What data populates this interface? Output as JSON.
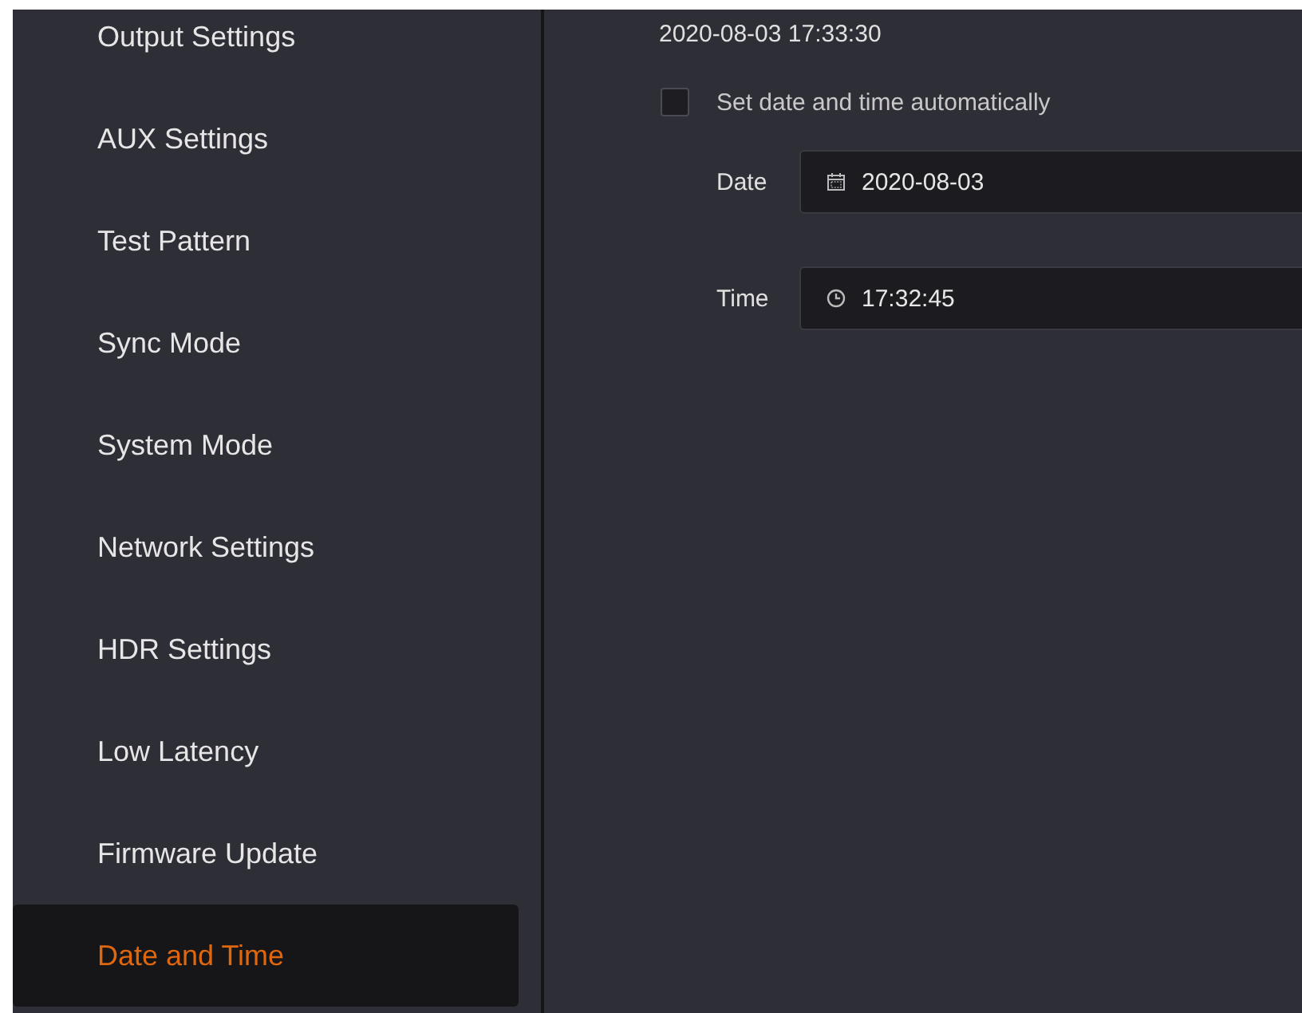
{
  "sidebar": {
    "items": [
      {
        "label": "Output Settings",
        "selected": false
      },
      {
        "label": "AUX Settings",
        "selected": false
      },
      {
        "label": "Test Pattern",
        "selected": false
      },
      {
        "label": "Sync Mode",
        "selected": false
      },
      {
        "label": "System Mode",
        "selected": false
      },
      {
        "label": "Network Settings",
        "selected": false
      },
      {
        "label": "HDR Settings",
        "selected": false
      },
      {
        "label": "Low Latency",
        "selected": false
      },
      {
        "label": "Firmware Update",
        "selected": false
      },
      {
        "label": "Date and Time",
        "selected": true
      }
    ]
  },
  "current_time": "2020-08-03 17:33:30",
  "auto_time": {
    "label": "Set date and time automatically",
    "checked": false
  },
  "fields": [
    {
      "kind": "date",
      "label": "Date",
      "value": "2020-08-03"
    },
    {
      "kind": "time",
      "label": "Time",
      "value": "17:32:45"
    }
  ]
}
